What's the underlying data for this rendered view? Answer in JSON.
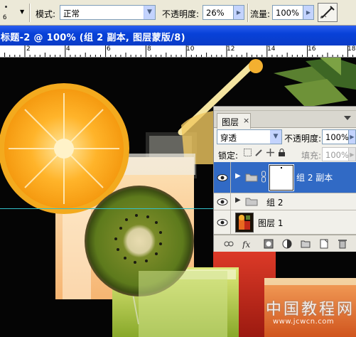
{
  "options_bar": {
    "brush_size": "6",
    "mode_label": "模式:",
    "mode_value": "正常",
    "opacity_label": "不透明度:",
    "opacity_value": "26%",
    "flow_label": "流量:",
    "flow_value": "100%"
  },
  "document": {
    "title": "标题-2 @ 100% (组 2 副本, 图层蒙版/8)"
  },
  "ruler": {
    "labels": [
      "2",
      "4",
      "6",
      "8",
      "10",
      "12",
      "14",
      "16",
      "18"
    ]
  },
  "watermark": {
    "text": "中国教程网",
    "url": "www.jcwcn.com"
  },
  "layers_panel": {
    "tab_label": "图层",
    "close_glyph": "×",
    "blend_mode": "穿透",
    "opacity_label": "不透明度:",
    "opacity_value": "100%",
    "lock_label": "锁定:",
    "fill_label": "填充:",
    "fill_value": "100%",
    "layers": [
      {
        "name": "组 2 副本",
        "selected": true
      },
      {
        "name": "组 2",
        "selected": false
      },
      {
        "name": "图层 1",
        "selected": false
      }
    ]
  },
  "colors": {
    "title_bar": "#0a44d8",
    "selection": "#316ac5",
    "guide": "#33c0c8"
  }
}
